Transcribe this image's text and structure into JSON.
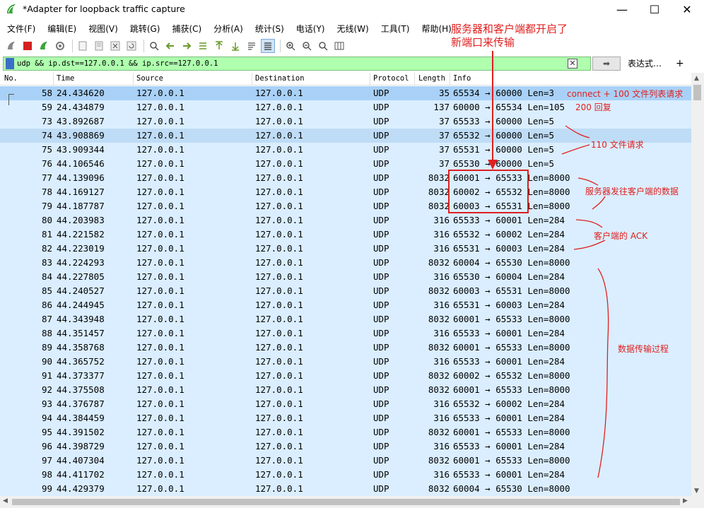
{
  "window": {
    "title": "*Adapter for loopback traffic capture",
    "min_glyph": "—",
    "max_glyph": "☐",
    "close_glyph": "✕"
  },
  "menu": [
    "文件(F)",
    "编辑(E)",
    "视图(V)",
    "跳转(G)",
    "捕获(C)",
    "分析(A)",
    "统计(S)",
    "电话(Y)",
    "无线(W)",
    "工具(T)",
    "帮助(H)"
  ],
  "filter": {
    "value": "udp && ip.dst==127.0.0.1 && ip.src==127.0.0.1",
    "expression_label": "表达式…",
    "add_label": "+",
    "clear_glyph": "✕",
    "apply_glyph": "➡"
  },
  "columns": {
    "no": "No.",
    "time": "Time",
    "source": "Source",
    "destination": "Destination",
    "protocol": "Protocol",
    "length": "Length",
    "info": "Info"
  },
  "packets": [
    {
      "no": "58",
      "time": "24.434620",
      "source": "127.0.0.1",
      "destination": "127.0.0.1",
      "protocol": "UDP",
      "length": "35",
      "info": "65534 → 60000 Len=3"
    },
    {
      "no": "59",
      "time": "24.434879",
      "source": "127.0.0.1",
      "destination": "127.0.0.1",
      "protocol": "UDP",
      "length": "137",
      "info": "60000 → 65534 Len=105"
    },
    {
      "no": "73",
      "time": "43.892687",
      "source": "127.0.0.1",
      "destination": "127.0.0.1",
      "protocol": "UDP",
      "length": "37",
      "info": "65533 → 60000 Len=5"
    },
    {
      "no": "74",
      "time": "43.908869",
      "source": "127.0.0.1",
      "destination": "127.0.0.1",
      "protocol": "UDP",
      "length": "37",
      "info": "65532 → 60000 Len=5"
    },
    {
      "no": "75",
      "time": "43.909344",
      "source": "127.0.0.1",
      "destination": "127.0.0.1",
      "protocol": "UDP",
      "length": "37",
      "info": "65531 → 60000 Len=5"
    },
    {
      "no": "76",
      "time": "44.106546",
      "source": "127.0.0.1",
      "destination": "127.0.0.1",
      "protocol": "UDP",
      "length": "37",
      "info": "65530 → 60000 Len=5"
    },
    {
      "no": "77",
      "time": "44.139096",
      "source": "127.0.0.1",
      "destination": "127.0.0.1",
      "protocol": "UDP",
      "length": "8032",
      "info": "60001 → 65533 Len=8000"
    },
    {
      "no": "78",
      "time": "44.169127",
      "source": "127.0.0.1",
      "destination": "127.0.0.1",
      "protocol": "UDP",
      "length": "8032",
      "info": "60002 → 65532 Len=8000"
    },
    {
      "no": "79",
      "time": "44.187787",
      "source": "127.0.0.1",
      "destination": "127.0.0.1",
      "protocol": "UDP",
      "length": "8032",
      "info": "60003 → 65531 Len=8000"
    },
    {
      "no": "80",
      "time": "44.203983",
      "source": "127.0.0.1",
      "destination": "127.0.0.1",
      "protocol": "UDP",
      "length": "316",
      "info": "65533 → 60001 Len=284"
    },
    {
      "no": "81",
      "time": "44.221582",
      "source": "127.0.0.1",
      "destination": "127.0.0.1",
      "protocol": "UDP",
      "length": "316",
      "info": "65532 → 60002 Len=284"
    },
    {
      "no": "82",
      "time": "44.223019",
      "source": "127.0.0.1",
      "destination": "127.0.0.1",
      "protocol": "UDP",
      "length": "316",
      "info": "65531 → 60003 Len=284"
    },
    {
      "no": "83",
      "time": "44.224293",
      "source": "127.0.0.1",
      "destination": "127.0.0.1",
      "protocol": "UDP",
      "length": "8032",
      "info": "60004 → 65530 Len=8000"
    },
    {
      "no": "84",
      "time": "44.227805",
      "source": "127.0.0.1",
      "destination": "127.0.0.1",
      "protocol": "UDP",
      "length": "316",
      "info": "65530 → 60004 Len=284"
    },
    {
      "no": "85",
      "time": "44.240527",
      "source": "127.0.0.1",
      "destination": "127.0.0.1",
      "protocol": "UDP",
      "length": "8032",
      "info": "60003 → 65531 Len=8000"
    },
    {
      "no": "86",
      "time": "44.244945",
      "source": "127.0.0.1",
      "destination": "127.0.0.1",
      "protocol": "UDP",
      "length": "316",
      "info": "65531 → 60003 Len=284"
    },
    {
      "no": "87",
      "time": "44.343948",
      "source": "127.0.0.1",
      "destination": "127.0.0.1",
      "protocol": "UDP",
      "length": "8032",
      "info": "60001 → 65533 Len=8000"
    },
    {
      "no": "88",
      "time": "44.351457",
      "source": "127.0.0.1",
      "destination": "127.0.0.1",
      "protocol": "UDP",
      "length": "316",
      "info": "65533 → 60001 Len=284"
    },
    {
      "no": "89",
      "time": "44.358768",
      "source": "127.0.0.1",
      "destination": "127.0.0.1",
      "protocol": "UDP",
      "length": "8032",
      "info": "60001 → 65533 Len=8000"
    },
    {
      "no": "90",
      "time": "44.365752",
      "source": "127.0.0.1",
      "destination": "127.0.0.1",
      "protocol": "UDP",
      "length": "316",
      "info": "65533 → 60001 Len=284"
    },
    {
      "no": "91",
      "time": "44.373377",
      "source": "127.0.0.1",
      "destination": "127.0.0.1",
      "protocol": "UDP",
      "length": "8032",
      "info": "60002 → 65532 Len=8000"
    },
    {
      "no": "92",
      "time": "44.375508",
      "source": "127.0.0.1",
      "destination": "127.0.0.1",
      "protocol": "UDP",
      "length": "8032",
      "info": "60001 → 65533 Len=8000"
    },
    {
      "no": "93",
      "time": "44.376787",
      "source": "127.0.0.1",
      "destination": "127.0.0.1",
      "protocol": "UDP",
      "length": "316",
      "info": "65532 → 60002 Len=284"
    },
    {
      "no": "94",
      "time": "44.384459",
      "source": "127.0.0.1",
      "destination": "127.0.0.1",
      "protocol": "UDP",
      "length": "316",
      "info": "65533 → 60001 Len=284"
    },
    {
      "no": "95",
      "time": "44.391502",
      "source": "127.0.0.1",
      "destination": "127.0.0.1",
      "protocol": "UDP",
      "length": "8032",
      "info": "60001 → 65533 Len=8000"
    },
    {
      "no": "96",
      "time": "44.398729",
      "source": "127.0.0.1",
      "destination": "127.0.0.1",
      "protocol": "UDP",
      "length": "316",
      "info": "65533 → 60001 Len=284"
    },
    {
      "no": "97",
      "time": "44.407304",
      "source": "127.0.0.1",
      "destination": "127.0.0.1",
      "protocol": "UDP",
      "length": "8032",
      "info": "60001 → 65533 Len=8000"
    },
    {
      "no": "98",
      "time": "44.411702",
      "source": "127.0.0.1",
      "destination": "127.0.0.1",
      "protocol": "UDP",
      "length": "316",
      "info": "65533 → 60001 Len=284"
    },
    {
      "no": "99",
      "time": "44.429379",
      "source": "127.0.0.1",
      "destination": "127.0.0.1",
      "protocol": "UDP",
      "length": "8032",
      "info": "60004 → 65530 Len=8000"
    }
  ],
  "annotations": {
    "top_line1": "服务器和客户端都开启了",
    "top_line2": "新端口来传输",
    "connect": "connect + 100 文件列表请求",
    "reply": "200 回复",
    "file_request": "110 文件请求",
    "server_data": "服务器发往客户端的数据",
    "client_ack": "客户端的 ACK",
    "transfer": "数据传输过程"
  },
  "colors": {
    "row_bg": "#daeeff",
    "selected_bg": "#a9d1f7",
    "filter_bg": "#afffaf",
    "annotation": "#e02020"
  }
}
